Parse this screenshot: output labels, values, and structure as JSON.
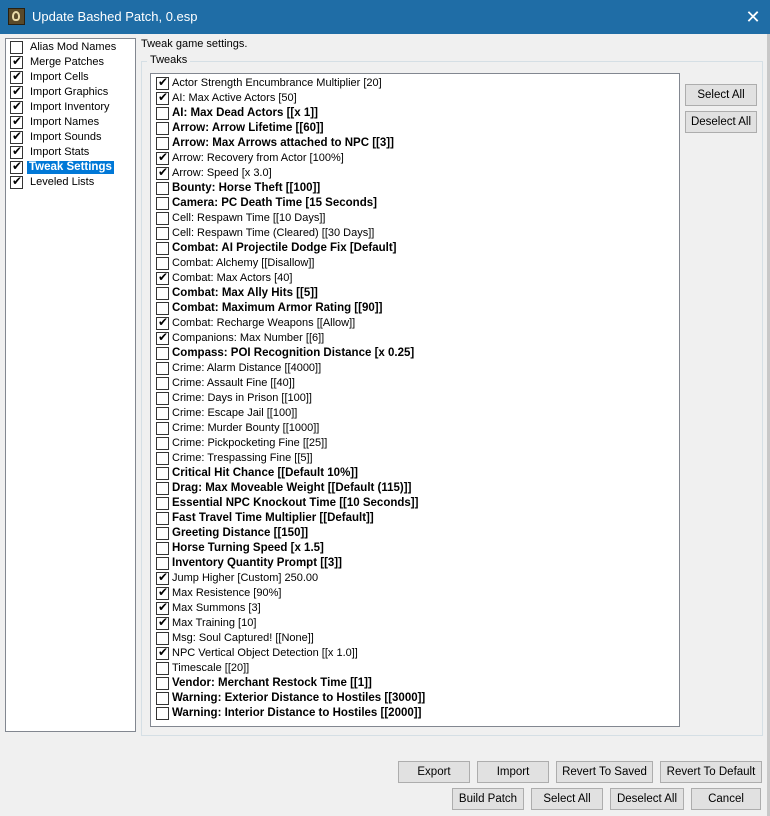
{
  "window": {
    "title": "Update Bashed Patch, 0.esp",
    "close_glyph": "✕"
  },
  "sidebar": {
    "items": [
      {
        "label": "Alias Mod Names",
        "checked": false
      },
      {
        "label": "Merge Patches",
        "checked": true
      },
      {
        "label": "Import Cells",
        "checked": true
      },
      {
        "label": "Import Graphics",
        "checked": true
      },
      {
        "label": "Import Inventory",
        "checked": true
      },
      {
        "label": "Import Names",
        "checked": true
      },
      {
        "label": "Import Sounds",
        "checked": true
      },
      {
        "label": "Import Stats",
        "checked": true
      },
      {
        "label": "Tweak Settings",
        "checked": true,
        "selected": true
      },
      {
        "label": "Leveled Lists",
        "checked": true
      }
    ]
  },
  "description": "Tweak game settings.",
  "tweaks": {
    "group_label": "Tweaks",
    "items": [
      {
        "label": "Actor Strength Encumbrance Multiplier [20]",
        "checked": true,
        "bold": false
      },
      {
        "label": "AI: Max Active Actors [50]",
        "checked": true,
        "bold": false
      },
      {
        "label": "AI: Max Dead Actors [[x 1]]",
        "checked": false,
        "bold": true
      },
      {
        "label": "Arrow: Arrow Lifetime [[60]]",
        "checked": false,
        "bold": true
      },
      {
        "label": "Arrow: Max Arrows attached to NPC [[3]]",
        "checked": false,
        "bold": true
      },
      {
        "label": "Arrow: Recovery from Actor [100%]",
        "checked": true,
        "bold": false
      },
      {
        "label": "Arrow: Speed [x 3.0]",
        "checked": true,
        "bold": false
      },
      {
        "label": "Bounty: Horse Theft [[100]]",
        "checked": false,
        "bold": true
      },
      {
        "label": "Camera: PC Death Time [15 Seconds]",
        "checked": false,
        "bold": true
      },
      {
        "label": "Cell: Respawn Time [[10 Days]]",
        "checked": false,
        "bold": false
      },
      {
        "label": "Cell: Respawn Time (Cleared) [[30 Days]]",
        "checked": false,
        "bold": false
      },
      {
        "label": "Combat: AI Projectile Dodge Fix [Default]",
        "checked": false,
        "bold": true
      },
      {
        "label": "Combat: Alchemy [[Disallow]]",
        "checked": false,
        "bold": false
      },
      {
        "label": "Combat: Max Actors [40]",
        "checked": true,
        "bold": false
      },
      {
        "label": "Combat: Max Ally Hits [[5]]",
        "checked": false,
        "bold": true
      },
      {
        "label": "Combat: Maximum Armor Rating [[90]]",
        "checked": false,
        "bold": true
      },
      {
        "label": "Combat: Recharge Weapons [[Allow]]",
        "checked": true,
        "bold": false
      },
      {
        "label": "Companions: Max Number [[6]]",
        "checked": true,
        "bold": false
      },
      {
        "label": "Compass: POI Recognition Distance [x 0.25]",
        "checked": false,
        "bold": true
      },
      {
        "label": "Crime: Alarm Distance [[4000]]",
        "checked": false,
        "bold": false
      },
      {
        "label": "Crime: Assault Fine [[40]]",
        "checked": false,
        "bold": false
      },
      {
        "label": "Crime: Days in Prison [[100]]",
        "checked": false,
        "bold": false
      },
      {
        "label": "Crime: Escape Jail [[100]]",
        "checked": false,
        "bold": false
      },
      {
        "label": "Crime: Murder Bounty [[1000]]",
        "checked": false,
        "bold": false
      },
      {
        "label": "Crime: Pickpocketing Fine [[25]]",
        "checked": false,
        "bold": false
      },
      {
        "label": "Crime: Trespassing Fine [[5]]",
        "checked": false,
        "bold": false
      },
      {
        "label": "Critical Hit Chance [[Default 10%]]",
        "checked": false,
        "bold": true
      },
      {
        "label": "Drag: Max Moveable Weight [[Default (115)]]",
        "checked": false,
        "bold": true
      },
      {
        "label": "Essential NPC Knockout Time [[10 Seconds]]",
        "checked": false,
        "bold": true
      },
      {
        "label": "Fast Travel Time Multiplier [[Default]]",
        "checked": false,
        "bold": true
      },
      {
        "label": "Greeting Distance [[150]]",
        "checked": false,
        "bold": true
      },
      {
        "label": "Horse Turning Speed [x 1.5]",
        "checked": false,
        "bold": true
      },
      {
        "label": "Inventory Quantity Prompt [[3]]",
        "checked": false,
        "bold": true
      },
      {
        "label": "Jump Higher [Custom] 250.00",
        "checked": true,
        "bold": false
      },
      {
        "label": "Max Resistence [90%]",
        "checked": true,
        "bold": false
      },
      {
        "label": "Max Summons [3]",
        "checked": true,
        "bold": false
      },
      {
        "label": "Max Training [10]",
        "checked": true,
        "bold": false
      },
      {
        "label": "Msg: Soul Captured! [[None]]",
        "checked": false,
        "bold": false
      },
      {
        "label": "NPC Vertical Object Detection [[x 1.0]]",
        "checked": true,
        "bold": false
      },
      {
        "label": "Timescale [[20]]",
        "checked": false,
        "bold": false
      },
      {
        "label": "Vendor: Merchant Restock Time [[1]]",
        "checked": false,
        "bold": true
      },
      {
        "label": "Warning: Exterior Distance to Hostiles [[3000]]",
        "checked": false,
        "bold": true
      },
      {
        "label": "Warning: Interior Distance to Hostiles [[2000]]",
        "checked": false,
        "bold": true
      }
    ]
  },
  "side_buttons": {
    "select_all": "Select All",
    "deselect_all": "Deselect All"
  },
  "footer": {
    "export": "Export",
    "import": "Import",
    "revert_saved": "Revert To Saved",
    "revert_default": "Revert To Default",
    "build_patch": "Build Patch",
    "select_all": "Select All",
    "deselect_all": "Deselect All",
    "cancel": "Cancel"
  }
}
